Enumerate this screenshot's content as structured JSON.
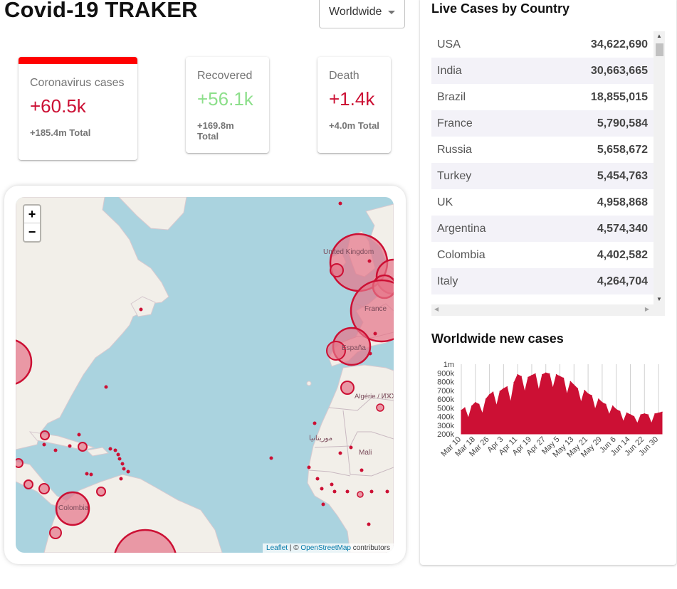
{
  "app": {
    "title": "Covid-19 TRAKER"
  },
  "region_select": {
    "value": "Worldwide"
  },
  "cards": {
    "cases": {
      "title": "Coronavirus cases",
      "value": "+60.5k",
      "total": "+185.4m Total"
    },
    "recovered": {
      "title": "Recovered",
      "value": "+56.1k",
      "total": "+169.8m Total"
    },
    "deaths": {
      "title": "Death",
      "value": "+1.4k",
      "total": "+4.0m Total"
    }
  },
  "map": {
    "zoom_in_label": "+",
    "zoom_out_label": "−",
    "labels": [
      "United Kingdom",
      "France",
      "España",
      "Algérie / ⵍⵣⵣⴰⵢⴻⵔ / الجزائر",
      "موريتانيا",
      "Mali",
      "Colombia"
    ],
    "attribution": {
      "leaflet": "Leaflet",
      "separator": " | © ",
      "osm": "OpenStreetMap",
      "suffix": " contributors"
    }
  },
  "live_cases": {
    "title": "Live Cases by Country",
    "rows": [
      {
        "country": "USA",
        "cases": "34,622,690"
      },
      {
        "country": "India",
        "cases": "30,663,665"
      },
      {
        "country": "Brazil",
        "cases": "18,855,015"
      },
      {
        "country": "France",
        "cases": "5,790,584"
      },
      {
        "country": "Russia",
        "cases": "5,658,672"
      },
      {
        "country": "Turkey",
        "cases": "5,454,763"
      },
      {
        "country": "UK",
        "cases": "4,958,868"
      },
      {
        "country": "Argentina",
        "cases": "4,574,340"
      },
      {
        "country": "Colombia",
        "cases": "4,402,582"
      },
      {
        "country": "Italy",
        "cases": "4,264,704"
      }
    ]
  },
  "chart": {
    "title": "Worldwide new cases"
  },
  "chart_data": {
    "type": "area",
    "title": "Worldwide new cases",
    "color": "#cc1034",
    "y_ticks": [
      "200k",
      "300k",
      "400k",
      "500k",
      "600k",
      "700k",
      "800k",
      "900k",
      "1m"
    ],
    "ylim": [
      200000,
      1000000
    ],
    "x_ticks": [
      "Mar 10",
      "Mar 18",
      "Mar 26",
      "Apr 3",
      "Apr 11",
      "Apr 19",
      "Apr 27",
      "May 5",
      "May 13",
      "May 21",
      "May 29",
      "Jun 6",
      "Jun 14",
      "Jun 22",
      "Jun 30"
    ],
    "x": [
      "Mar 10",
      "Mar 12",
      "Mar 14",
      "Mar 16",
      "Mar 18",
      "Mar 20",
      "Mar 22",
      "Mar 24",
      "Mar 26",
      "Mar 28",
      "Mar 30",
      "Apr 1",
      "Apr 3",
      "Apr 5",
      "Apr 7",
      "Apr 9",
      "Apr 11",
      "Apr 13",
      "Apr 15",
      "Apr 17",
      "Apr 19",
      "Apr 21",
      "Apr 23",
      "Apr 25",
      "Apr 27",
      "Apr 29",
      "May 1",
      "May 3",
      "May 5",
      "May 7",
      "May 9",
      "May 11",
      "May 13",
      "May 15",
      "May 17",
      "May 19",
      "May 21",
      "May 23",
      "May 25",
      "May 27",
      "May 29",
      "May 31",
      "Jun 2",
      "Jun 4",
      "Jun 6",
      "Jun 8",
      "Jun 10",
      "Jun 12",
      "Jun 14",
      "Jun 16",
      "Jun 18",
      "Jun 20",
      "Jun 22",
      "Jun 24",
      "Jun 26",
      "Jun 28",
      "Jun 30",
      "Jul 2"
    ],
    "values": [
      470000,
      500000,
      380000,
      520000,
      560000,
      540000,
      430000,
      600000,
      650000,
      680000,
      520000,
      690000,
      720000,
      740000,
      560000,
      790000,
      880000,
      860000,
      680000,
      850000,
      870000,
      890000,
      700000,
      880000,
      900000,
      890000,
      720000,
      880000,
      860000,
      840000,
      650000,
      800000,
      760000,
      720000,
      560000,
      700000,
      660000,
      640000,
      480000,
      600000,
      560000,
      540000,
      420000,
      520000,
      480000,
      460000,
      340000,
      440000,
      420000,
      400000,
      320000,
      420000,
      430000,
      420000,
      320000,
      430000,
      440000,
      450000
    ]
  }
}
